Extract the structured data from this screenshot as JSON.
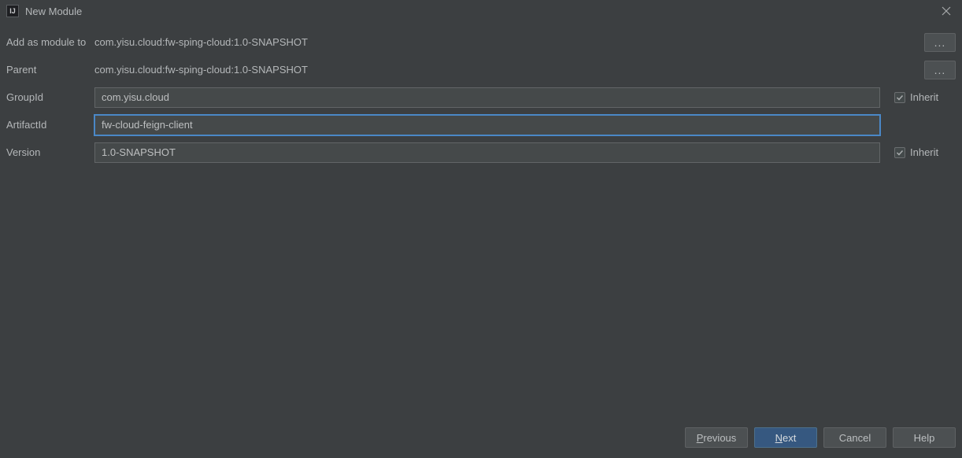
{
  "titlebar": {
    "icon_letters": "IJ",
    "title": "New Module"
  },
  "form": {
    "add_as_module_label": "Add as module to",
    "add_as_module_value": "com.yisu.cloud:fw-sping-cloud:1.0-SNAPSHOT",
    "parent_label": "Parent",
    "parent_value": "com.yisu.cloud:fw-sping-cloud:1.0-SNAPSHOT",
    "groupid_label": "GroupId",
    "groupid_value": "com.yisu.cloud",
    "artifactid_label": "ArtifactId",
    "artifactid_value": "fw-cloud-feign-client",
    "version_label": "Version",
    "version_value": "1.0-SNAPSHOT",
    "inherit_label": "Inherit",
    "dots": "..."
  },
  "buttons": {
    "previous": "revious",
    "previous_m": "P",
    "next": "ext",
    "next_m": "N",
    "cancel": "Cancel",
    "help": "Help"
  }
}
